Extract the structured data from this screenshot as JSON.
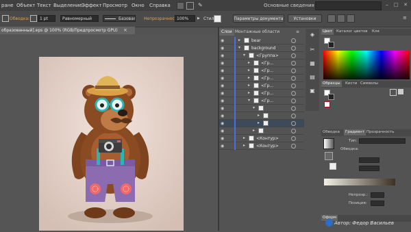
{
  "menu": {
    "items": [
      "ране",
      "Объект",
      "Текст",
      "Выделение",
      "Эффект",
      "Просмотр",
      "Окно",
      "Справка"
    ],
    "workspace": "Основные сведения",
    "window_buttons": [
      "‒",
      "□",
      "✕"
    ]
  },
  "controlbar": {
    "fill_label": "Обводка:",
    "stroke_weight": "1 pt",
    "profile": "Равномерный",
    "brush": "Базовая",
    "opacity_label": "Непрозрачность:",
    "opacity_value": "100%",
    "style_label": "Стиль:",
    "doc_setup_button": "Параметры документа",
    "prefs_button": "Установки"
  },
  "document": {
    "tab_title": "образованный].eps @ 100% (RGB/Предпросмотр GPU)",
    "close": "×"
  },
  "layers_panel": {
    "tabs": [
      "Слои",
      "Монтажные области"
    ],
    "rows": [
      {
        "name": "bear",
        "indent": 0,
        "expanded": false,
        "selected": false
      },
      {
        "name": "background",
        "indent": 0,
        "expanded": true,
        "selected": false
      },
      {
        "name": "<Группа>",
        "indent": 1,
        "expanded": true,
        "selected": false
      },
      {
        "name": "<Гр...",
        "indent": 2,
        "expanded": false,
        "selected": false
      },
      {
        "name": "<Гр...",
        "indent": 2,
        "expanded": false,
        "selected": false
      },
      {
        "name": "<Гр...",
        "indent": 2,
        "expanded": false,
        "selected": false
      },
      {
        "name": "<Гр...",
        "indent": 2,
        "expanded": false,
        "selected": false
      },
      {
        "name": "<Гр...",
        "indent": 2,
        "expanded": false,
        "selected": false
      },
      {
        "name": "<Гр...",
        "indent": 2,
        "expanded": true,
        "selected": false
      },
      {
        "name": "",
        "indent": 3,
        "expanded": true,
        "selected": false
      },
      {
        "name": "",
        "indent": 4,
        "expanded": false,
        "selected": false
      },
      {
        "name": "",
        "indent": 4,
        "expanded": false,
        "selected": true
      },
      {
        "name": "",
        "indent": 3,
        "expanded": false,
        "selected": false
      },
      {
        "name": "<Контур>",
        "indent": 1,
        "expanded": false,
        "selected": false
      },
      {
        "name": "<Контур>",
        "indent": 1,
        "expanded": false,
        "selected": false
      }
    ]
  },
  "right_panels": {
    "color_tabs": [
      "Цвет",
      "Каталог цветов",
      "Кля"
    ],
    "swatch_tabs": [
      "Образцы",
      "Кисти",
      "Символы"
    ],
    "gradient_tabs": [
      "Обводка",
      "Градиент",
      "Прозрачность"
    ],
    "gradient_type_label": "Тип:",
    "gradient_stroke_label": "Обводка:",
    "opacity_small_label": "Непрозр.:",
    "position_small_label": "Позиция:",
    "bottom_tab": "Оформ"
  },
  "watermark": "Автор: Федор Васильев",
  "colors": {
    "accent_blue": "#4c6ee0",
    "artboard": "#e2d0c7",
    "bear_brown": "#8a4a22",
    "pants_purple": "#8c6bb0"
  }
}
